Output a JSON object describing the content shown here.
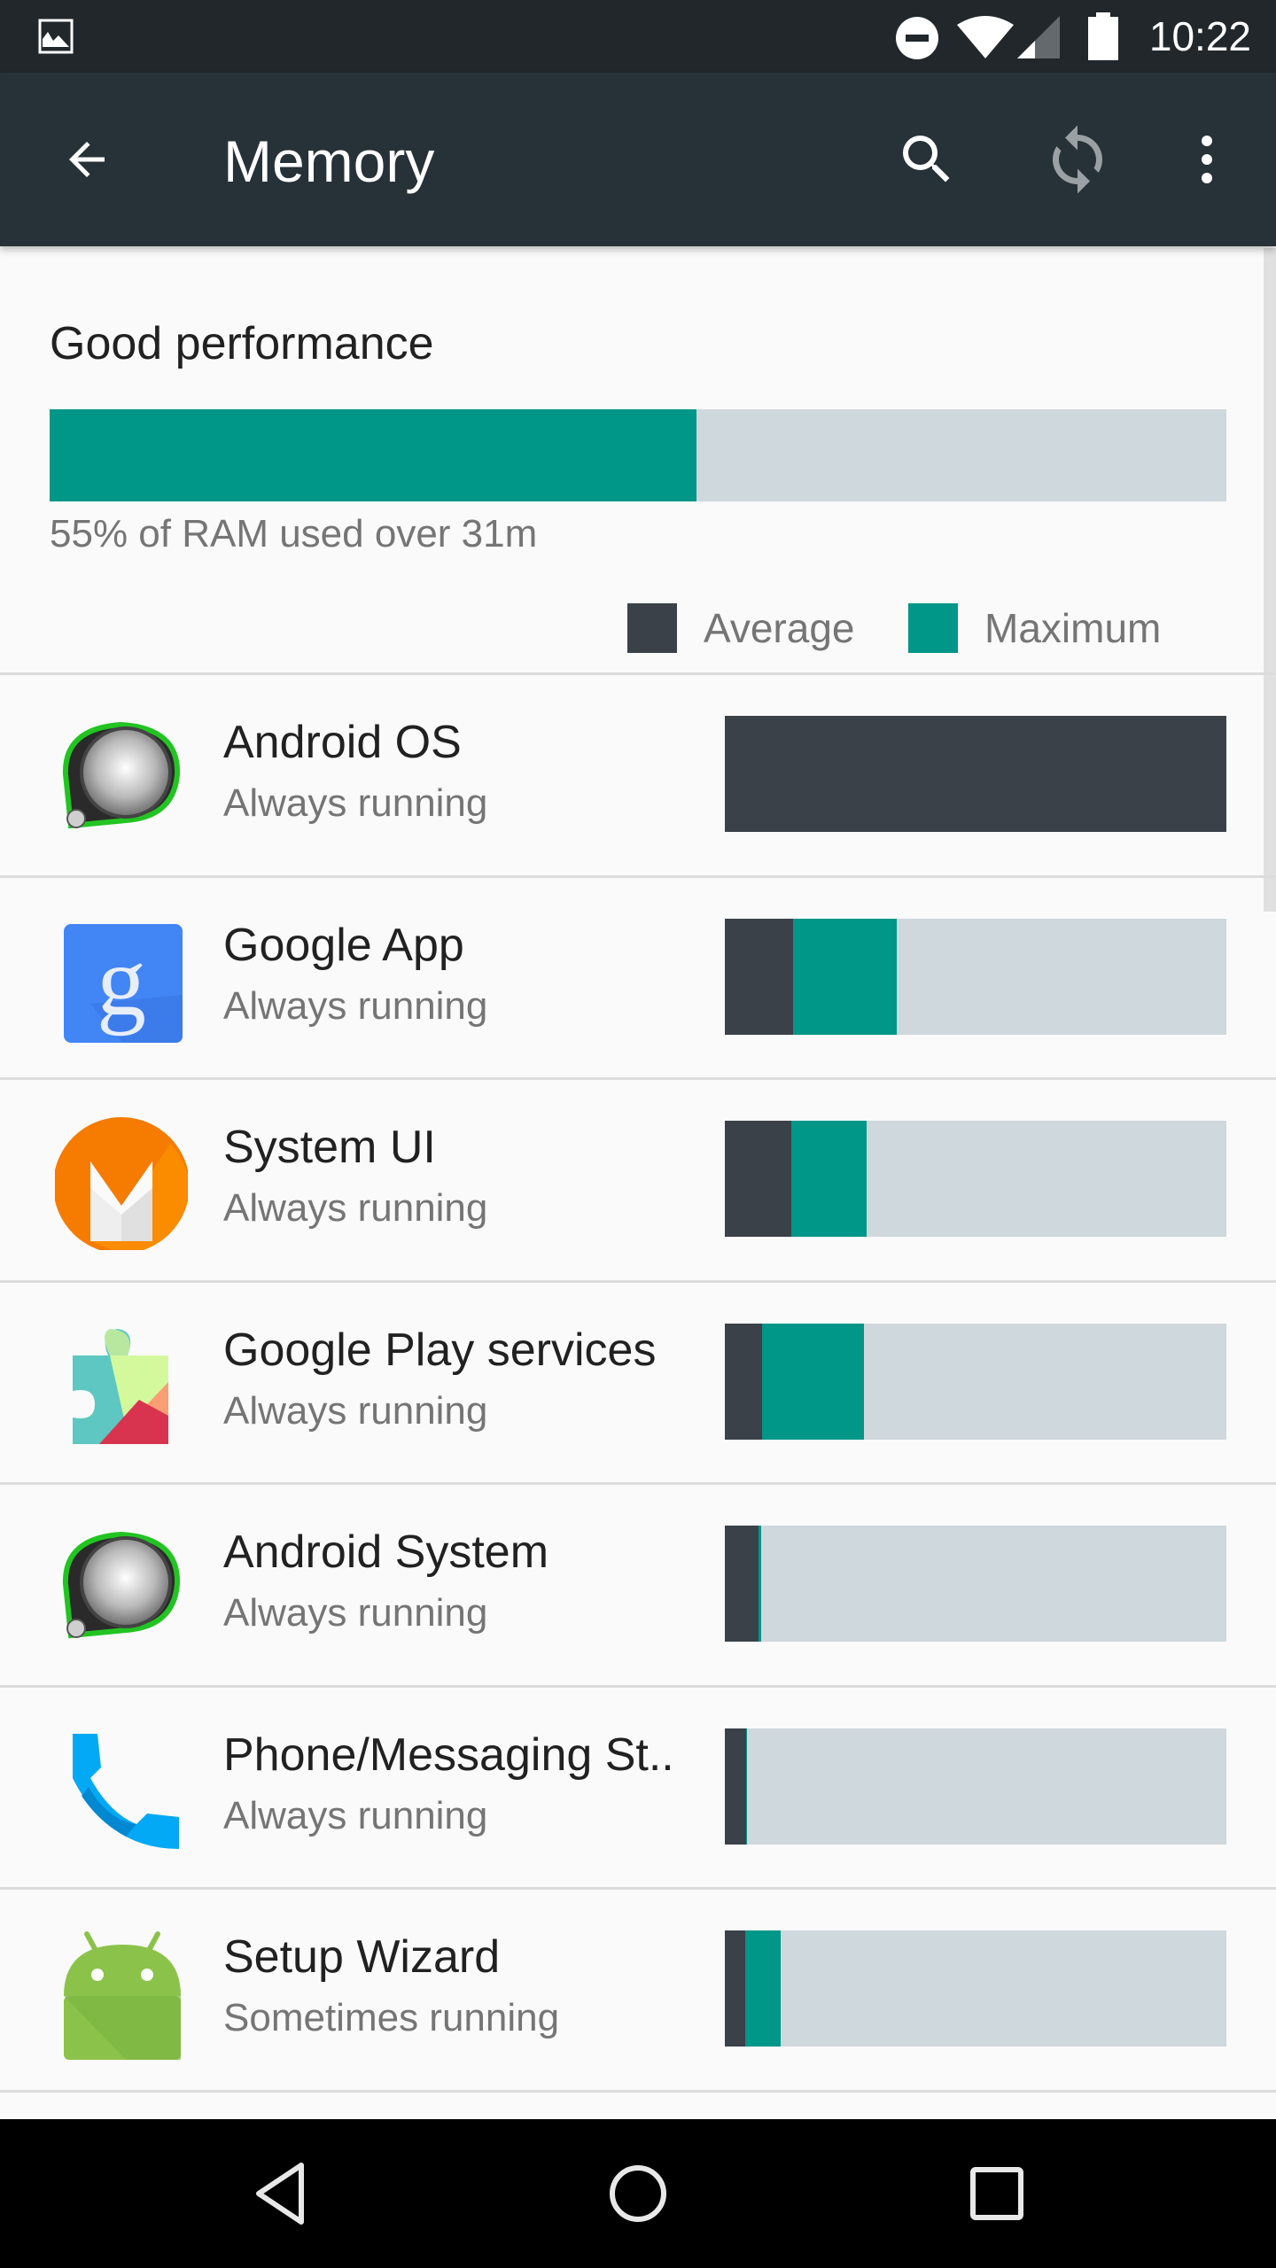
{
  "status_bar": {
    "time": "10:22",
    "icons": [
      "image-notification-icon",
      "do-not-disturb-icon",
      "wifi-icon",
      "cell-signal-icon",
      "battery-icon"
    ]
  },
  "toolbar": {
    "title": "Memory",
    "back_icon": "arrow-back-icon",
    "actions": [
      "search-icon",
      "refresh-icon",
      "more-vert-icon"
    ]
  },
  "summary": {
    "title": "Good performance",
    "used_percent": 55,
    "subtitle": "55% of RAM used over 31m",
    "legend": [
      {
        "label": "Average",
        "color": "#3a4149"
      },
      {
        "label": "Maximum",
        "color": "#009688"
      }
    ]
  },
  "colors": {
    "accent": "#009688",
    "average": "#3a4149",
    "track": "#cfd8dc",
    "toolbar": "#263238",
    "statusbar": "#22272b"
  },
  "apps": [
    {
      "name": "Android OS",
      "status": "Always running",
      "icon": "android-os-icon",
      "avg_pct": 100,
      "max_pct": 100
    },
    {
      "name": "Google App",
      "status": "Always running",
      "icon": "google-app-icon",
      "avg_pct": 13.6,
      "max_pct": 34.2
    },
    {
      "name": "System UI",
      "status": "Always running",
      "icon": "system-ui-icon",
      "avg_pct": 13.3,
      "max_pct": 28.3
    },
    {
      "name": "Google Play services",
      "status": "Always running",
      "icon": "google-play-services-icon",
      "avg_pct": 7.4,
      "max_pct": 27.8
    },
    {
      "name": "Android System",
      "status": "Always running",
      "icon": "android-system-icon",
      "avg_pct": 6.7,
      "max_pct": 7.3
    },
    {
      "name": "Phone/Messaging St..",
      "status": "Always running",
      "icon": "phone-icon",
      "avg_pct": 4.3,
      "max_pct": 4.4
    },
    {
      "name": "Setup Wizard",
      "status": "Sometimes running",
      "icon": "android-robot-icon",
      "avg_pct": 4.0,
      "max_pct": 11.1
    }
  ],
  "nav_bar": [
    "back-nav-icon",
    "home-nav-icon",
    "recents-nav-icon"
  ]
}
